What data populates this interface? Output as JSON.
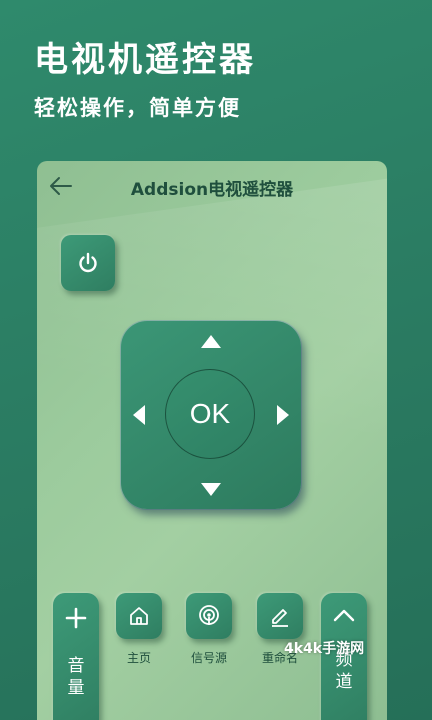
{
  "hero": {
    "title": "电视机遥控器",
    "subtitle": "轻松操作，简单方便"
  },
  "app": {
    "title": "Addsion电视遥控器",
    "back_icon": "back-arrow-icon"
  },
  "remote": {
    "power_icon": "power-icon",
    "ok_label": "OK",
    "volume_label": "音量",
    "channel_label": "频道",
    "home_label": "主页",
    "source_label": "信号源",
    "rename_label": "重命名"
  },
  "watermark": "4k4k手游网",
  "colors": {
    "background": "#2b7d63",
    "panel": "#9ccb9d",
    "button": "#358a6b",
    "text_dark": "#1f4f3d"
  }
}
